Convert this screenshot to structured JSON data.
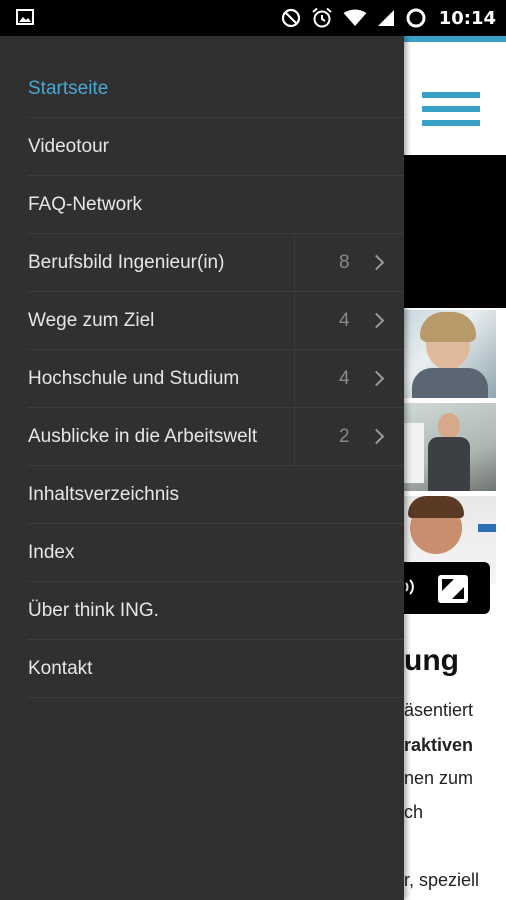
{
  "status_bar": {
    "time": "10:14",
    "icons": [
      "image-notification-icon",
      "do-not-disturb-icon",
      "alarm-icon",
      "wifi-icon",
      "signal-icon",
      "loading-circle-icon"
    ]
  },
  "background_page": {
    "heading_fragment": "ung",
    "text_fragments": [
      "äsentiert",
      "raktiven",
      "nen zum",
      "ch",
      "r, speziell"
    ],
    "accent_color": "#3aa0c8"
  },
  "drawer": {
    "active_color": "#4aa7cf",
    "items": [
      {
        "label": "Startseite",
        "count": null,
        "active": true
      },
      {
        "label": "Videotour",
        "count": null,
        "active": false
      },
      {
        "label": "FAQ-Network",
        "count": null,
        "active": false
      },
      {
        "label": "Berufsbild Ingenieur(in)",
        "count": "8",
        "active": false
      },
      {
        "label": "Wege zum Ziel",
        "count": "4",
        "active": false
      },
      {
        "label": "Hochschule und Studium",
        "count": "4",
        "active": false
      },
      {
        "label": "Ausblicke in die Arbeitswelt",
        "count": "2",
        "active": false
      },
      {
        "label": "Inhaltsverzeichnis",
        "count": null,
        "active": false
      },
      {
        "label": "Index",
        "count": null,
        "active": false
      },
      {
        "label": "Über think ING.",
        "count": null,
        "active": false
      },
      {
        "label": "Kontakt",
        "count": null,
        "active": false
      }
    ]
  }
}
